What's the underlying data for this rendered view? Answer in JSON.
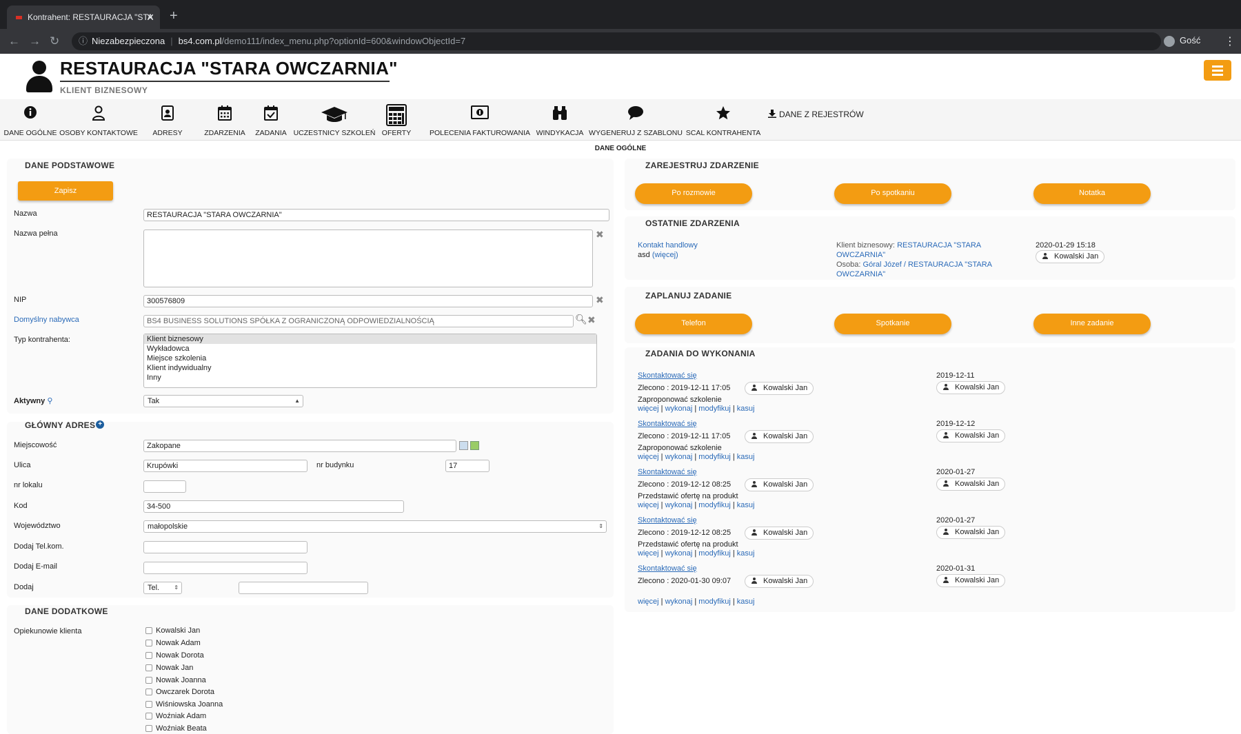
{
  "browser": {
    "tab_title": "Kontrahent: RESTAURACJA \"STA",
    "security": "Niezabezpieczona",
    "url_host": "bs4.com.pl",
    "url_path": "/demo111/index_menu.php?optionId=600&windowObjectId=7",
    "profile": "Gość"
  },
  "header": {
    "title": "RESTAURACJA \"STARA OWCZARNIA\"",
    "subtitle": "KLIENT BIZNESOWY"
  },
  "toolbar": {
    "items": [
      {
        "label": "DANE OGÓLNE",
        "icon": "info-icon"
      },
      {
        "label": "OSOBY KONTAKTOWE",
        "icon": "user-icon"
      },
      {
        "label": "ADRESY",
        "icon": "address-book-icon"
      },
      {
        "label": "ZDARZENIA",
        "icon": "calendar-icon"
      },
      {
        "label": "ZADANIA",
        "icon": "calendar-check-icon"
      },
      {
        "label": "UCZESTNICY SZKOLEŃ",
        "icon": "graduation-cap-icon"
      },
      {
        "label": "OFERTY",
        "icon": "calculator-icon"
      },
      {
        "label": "POLECENIA FAKTUROWANIA",
        "icon": "money-icon"
      },
      {
        "label": "WINDYKACJA",
        "icon": "binoculars-icon"
      },
      {
        "label": "WYGENERUJ Z SZABLONU",
        "icon": "speech-bubble-icon"
      },
      {
        "label": "SCAL KONTRAHENTA",
        "icon": "star-icon"
      }
    ],
    "registry_label": "DANE Z REJESTRÓW",
    "section_caption": "DANE OGÓLNE"
  },
  "basic": {
    "title": "DANE PODSTAWOWE",
    "save_label": "Zapisz",
    "name_label": "Nazwa",
    "name_value": "RESTAURACJA \"STARA OWCZARNIA\"",
    "fullname_label": "Nazwa pełna",
    "fullname_value": "",
    "nip_label": "NIP",
    "nip_value": "300576809",
    "buyer_label": "Domyślny nabywca",
    "buyer_value": "BS4 BUSINESS SOLUTIONS SPÓŁKA Z OGRANICZONĄ ODPOWIEDZIALNOŚCIĄ",
    "type_label": "Typ kontrahenta:",
    "type_options": [
      "Klient biznesowy",
      "Wykładowca",
      "Miejsce szkolenia",
      "Klient indywidualny",
      "Inny"
    ],
    "type_selected": "Klient biznesowy",
    "active_label": "Aktywny",
    "active_value": "Tak"
  },
  "address": {
    "title": "GŁÓWNY ADRES",
    "city_label": "Miejscowość",
    "city_value": "Zakopane",
    "street_label": "Ulica",
    "street_value": "Krupówki",
    "building_label": "nr budynku",
    "building_value": "17",
    "local_label": "nr lokalu",
    "local_value": "",
    "code_label": "Kod",
    "code_value": "34-500",
    "voivodeship_label": "Województwo",
    "voivodeship_value": "małopolskie",
    "phone_label": "Dodaj Tel.kom.",
    "phone_value": "",
    "email_label": "Dodaj E-mail",
    "email_value": "",
    "add_label": "Dodaj",
    "add_type_value": "Tel.",
    "add_value": ""
  },
  "extra": {
    "title": "DANE DODATKOWE",
    "guardians_label": "Opiekunowie klienta",
    "guardians": [
      "Kowalski Jan",
      "Nowak Adam",
      "Nowak Dorota",
      "Nowak Jan",
      "Nowak Joanna",
      "Owczarek Dorota",
      "Wiśniowska Joanna",
      "Woźniak Adam",
      "Woźniak Beata"
    ]
  },
  "register": {
    "title": "ZAREJESTRUJ ZDARZENIE",
    "buttons": [
      "Po rozmowie",
      "Po spotkaniu",
      "Notatka"
    ]
  },
  "recent": {
    "title": "OSTATNIE ZDARZENIA",
    "event_type": "Kontakt handlowy",
    "event_desc": "asd",
    "event_more": "(więcej)",
    "client_prefix": "Klient biznesowy:",
    "client_line1": "RESTAURACJA \"STARA",
    "client_line2": "OWCZARNIA\"",
    "person_prefix": "Osoba:",
    "person_line1": "Góral Józef / RESTAURACJA \"STARA",
    "person_line2": "OWCZARNIA\"",
    "datetime": "2020-01-29 15:18",
    "user": "Kowalski Jan"
  },
  "plan": {
    "title": "ZAPLANUJ ZADANIE",
    "buttons": [
      "Telefon",
      "Spotkanie",
      "Inne zadanie"
    ]
  },
  "tasks": {
    "title": "ZADANIA DO WYKONANIA",
    "actions": {
      "more": "więcej",
      "do": "wykonaj",
      "modify": "modyfikuj",
      "delete": "kasuj"
    },
    "items": [
      {
        "title": "Skontaktować się",
        "ordered": "Zlecono : 2019-12-11 17:05",
        "user": "Kowalski Jan",
        "desc": "Zaproponować szkolenie",
        "date": "2019-12-11",
        "assignee": "Kowalski Jan"
      },
      {
        "title": "Skontaktować się",
        "ordered": "Zlecono : 2019-12-11 17:05",
        "user": "Kowalski Jan",
        "desc": "Zaproponować szkolenie",
        "date": "2019-12-12",
        "assignee": "Kowalski Jan"
      },
      {
        "title": "Skontaktować się",
        "ordered": "Zlecono : 2019-12-12 08:25",
        "user": "Kowalski Jan",
        "desc": "Przedstawić ofertę na produkt",
        "date": "2020-01-27",
        "assignee": "Kowalski Jan"
      },
      {
        "title": "Skontaktować się",
        "ordered": "Zlecono : 2019-12-12 08:25",
        "user": "Kowalski Jan",
        "desc": "Przedstawić ofertę na produkt",
        "date": "2020-01-27",
        "assignee": "Kowalski Jan"
      },
      {
        "title": "Skontaktować się",
        "ordered": "Zlecono : 2020-01-30 09:07",
        "user": "Kowalski Jan",
        "desc": "",
        "date": "2020-01-31",
        "assignee": "Kowalski Jan"
      }
    ]
  },
  "colors": {
    "accent": "#f39c12",
    "link": "#2a6ab8"
  }
}
